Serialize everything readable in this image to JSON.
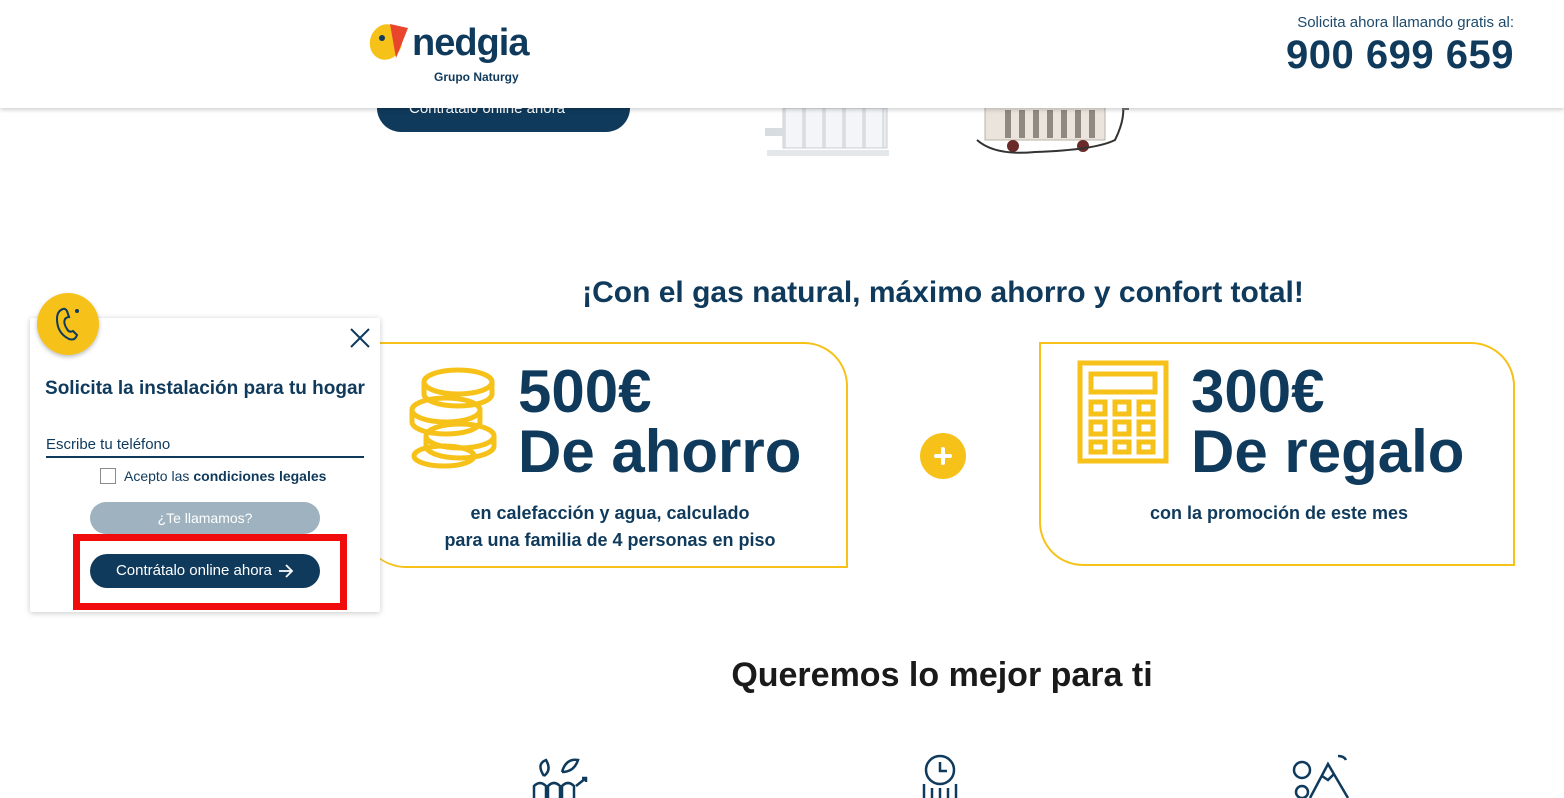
{
  "header": {
    "logo_text": "nedgia",
    "logo_subtitle": "Grupo Naturgy",
    "call_label": "Solicita ahora llamando gratis al:",
    "call_number": "900 699 659"
  },
  "top_cta_label": "Contrátalo online ahora",
  "main_heading": "¡Con el gas natural, máximo ahorro y confort total!",
  "card_left": {
    "amount": "500€",
    "headline": "De ahorro",
    "caption_line1": "en calefacción y agua, calculado",
    "caption_line2": "para una familia de 4 personas en piso"
  },
  "card_right": {
    "amount": "300€",
    "headline": "De regalo",
    "caption_line1": "con la promoción de este mes"
  },
  "section2_title": "Queremos lo mejor para ti",
  "popup": {
    "title": "Solicita la instalación para tu hogar",
    "phone_placeholder": "Escribe tu teléfono",
    "legal_prefix": "Acepto las",
    "legal_link": "condiciones legales",
    "callme_label": "¿Te llamamos?",
    "contract_label": "Contrátalo online ahora"
  },
  "colors": {
    "navy": "#0f3a5c",
    "yellow": "#f6c21a",
    "highlight": "#f00c0c",
    "disabled_button": "#9eb3bf"
  },
  "icons": [
    "phone-icon",
    "close-icon",
    "coins-icon",
    "calculator-icon",
    "plus-icon",
    "arrow-right-icon",
    "plants-icon",
    "clock-icon",
    "mountain-icon"
  ]
}
